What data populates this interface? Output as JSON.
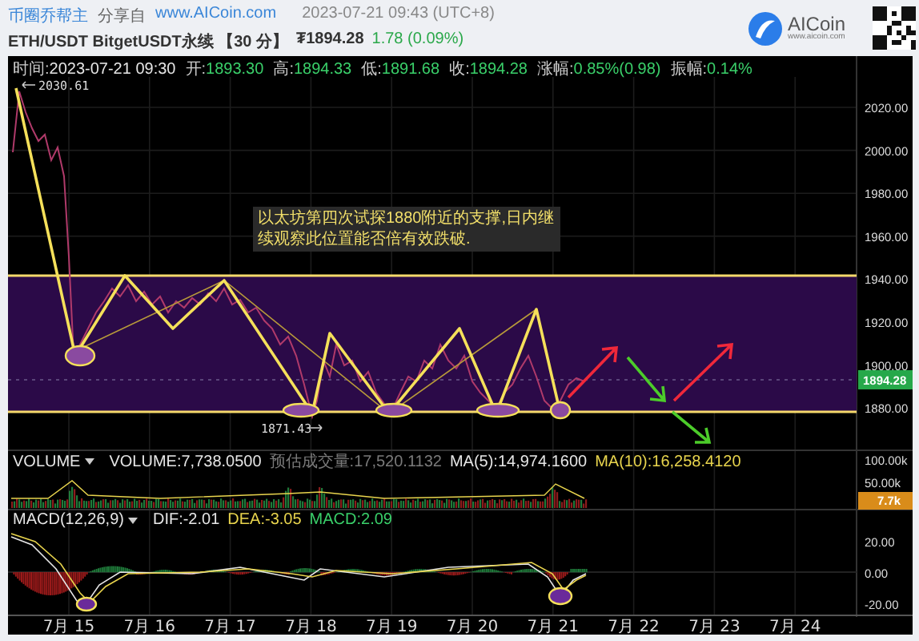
{
  "header": {
    "author": "币圈乔帮主",
    "share_prefix": "分享自",
    "site": "www.AICoin.com",
    "timestamp": "2023-07-21 09:43 (UTC+8)",
    "symbol": "ETH/USDT BitgetUSDT永续 【30 分】",
    "price": "₮1894.28",
    "change": "1.78 (0.09%)"
  },
  "logo": {
    "name": "AICoin",
    "url": "www.aicoin.com"
  },
  "ohlc": [
    {
      "label": "时间:",
      "value": "2023-07-21 09:30",
      "kind": "plain"
    },
    {
      "label": "开:",
      "value": "1893.30",
      "kind": "up"
    },
    {
      "label": "高:",
      "value": "1894.33",
      "kind": "up"
    },
    {
      "label": "低:",
      "value": "1891.68",
      "kind": "up"
    },
    {
      "label": "收:",
      "value": "1894.28",
      "kind": "up"
    },
    {
      "label": "涨幅:",
      "value": "0.85%(0.98)",
      "kind": "up"
    },
    {
      "label": "振幅:",
      "value": "0.14%",
      "kind": "up"
    }
  ],
  "price_axis": [
    "2020.00",
    "2000.00",
    "1980.00",
    "1960.00",
    "1940.00",
    "1920.00",
    "1900.00",
    "1880.00"
  ],
  "current_price": "1894.28",
  "high_marker": "2030.61",
  "low_marker": "1871.43",
  "annotation": "以太坊第四次试探1880附近的支撑,日内继续观察此位置能否倍有效跌破.",
  "volume": {
    "selector": "VOLUME",
    "items": [
      {
        "text": "VOLUME:7,738.0500",
        "kind": "plain"
      },
      {
        "text": "预估成交量:17,520.1132",
        "kind": "muted"
      },
      {
        "text": "MA(5):14,974.1600",
        "kind": "plain"
      },
      {
        "text": "MA(10):16,258.4120",
        "kind": "yellow"
      }
    ],
    "axis": [
      "100.00k",
      "50.00k"
    ],
    "current": "7.7k"
  },
  "macd": {
    "selector": "MACD(12,26,9)",
    "items": [
      {
        "text": "DIF:-2.01",
        "kind": "plain"
      },
      {
        "text": "DEA:-3.05",
        "kind": "yellow"
      },
      {
        "text": "MACD:2.09",
        "kind": "green"
      }
    ],
    "axis": [
      "20.00",
      "0.00",
      "-20.00"
    ]
  },
  "dates": [
    "7月 15",
    "7月 16",
    "7月 17",
    "7月 18",
    "7月 19",
    "7月 20",
    "7月 21",
    "7月 22",
    "7月 23",
    "7月 24"
  ]
}
